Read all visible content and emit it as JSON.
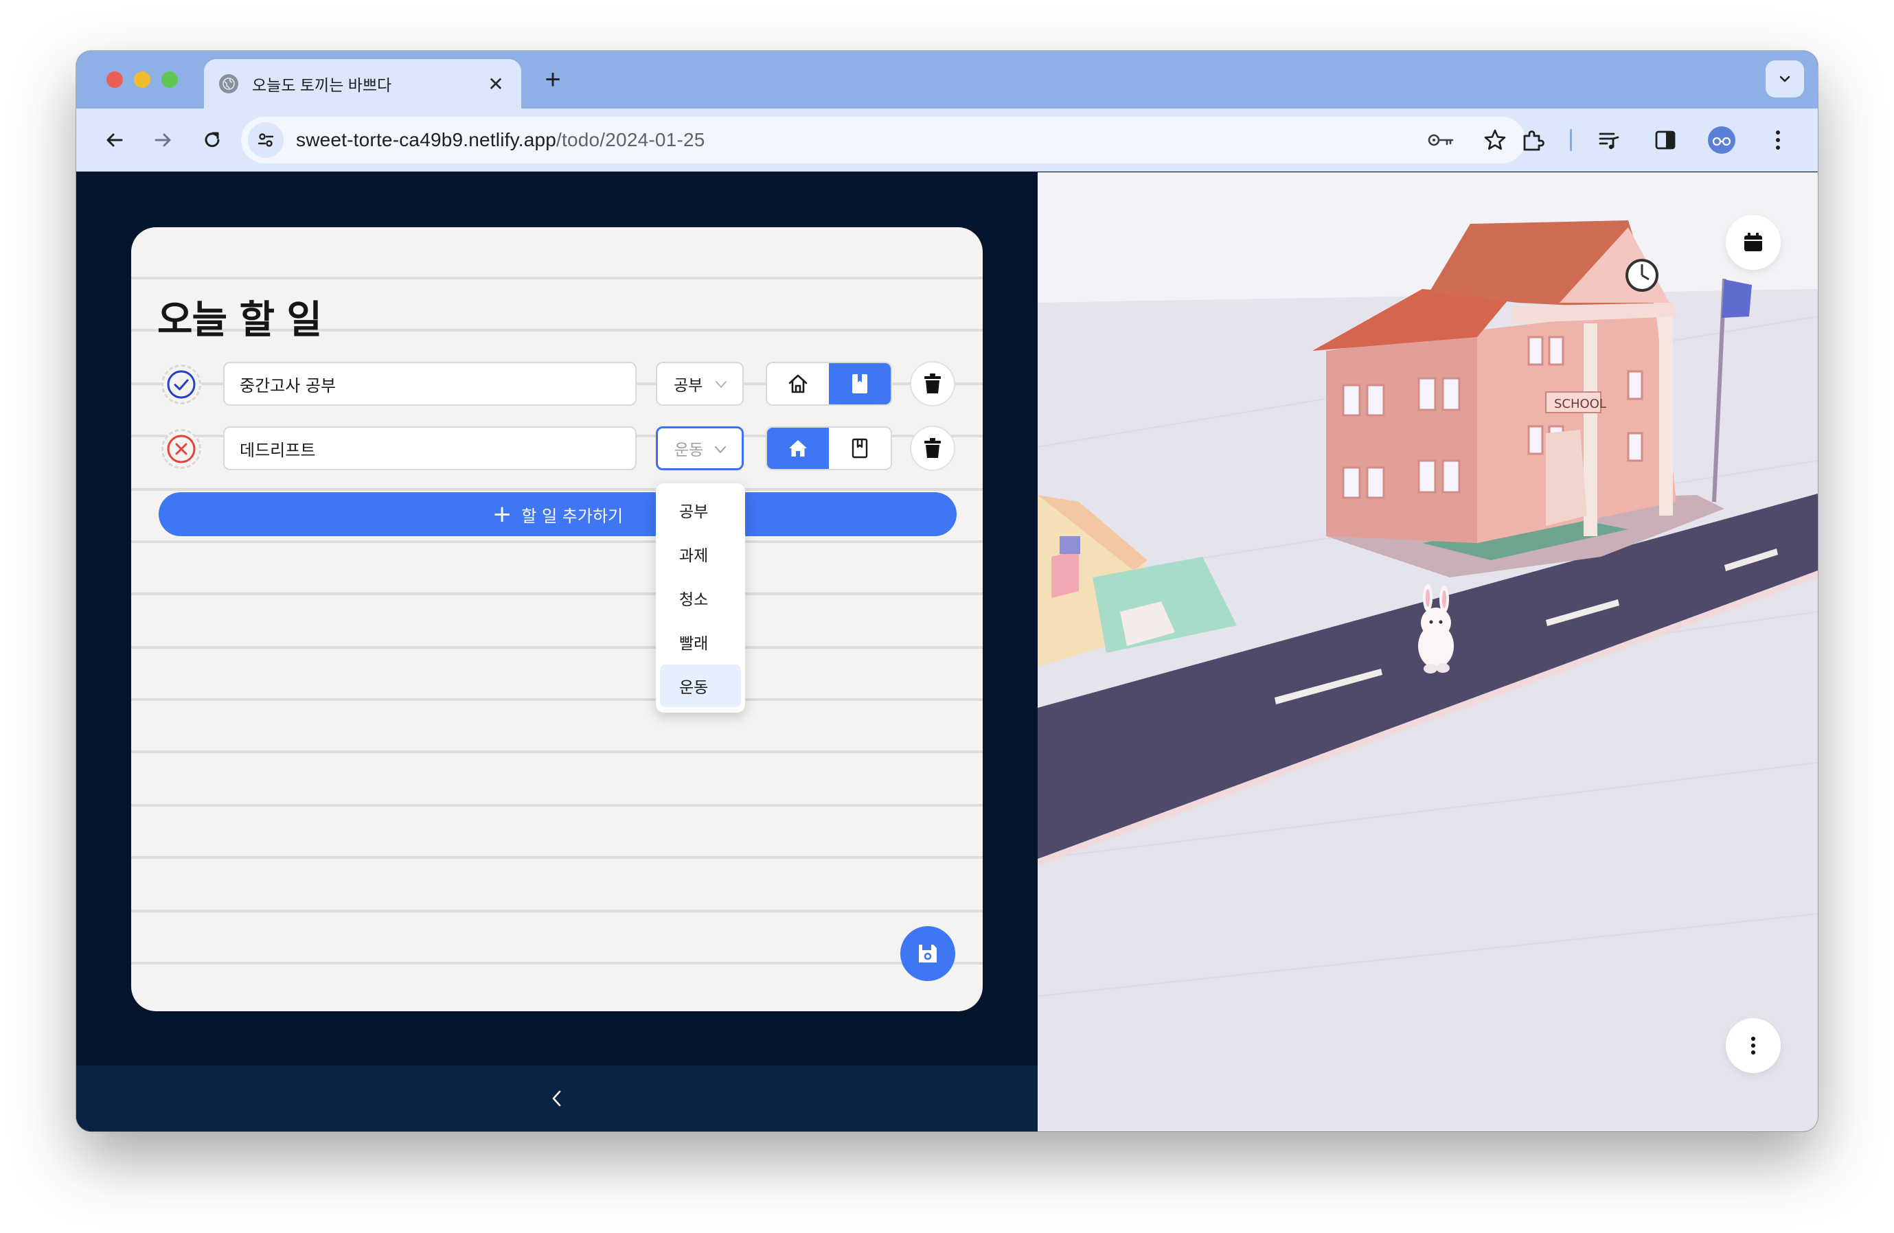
{
  "browser": {
    "tab_title": "오늘도 토끼는 바쁘다",
    "new_tab_symbol": "+",
    "close_symbol": "✕",
    "url_host": "sweet-torte-ca49b9.netlify.app",
    "url_path": "/todo/2024-01-25"
  },
  "todo": {
    "title": "오늘 할 일",
    "items": [
      {
        "text": "중간고사 공부",
        "category": "공부",
        "status": "done",
        "place": "book",
        "dropdown_open": false
      },
      {
        "text": "데드리프트",
        "category": "운동",
        "status": "failed",
        "place": "home",
        "dropdown_open": true
      }
    ],
    "add_label": "할 일 추가하기",
    "add_symbol": "+",
    "dropdown_options": [
      "공부",
      "과제",
      "청소",
      "빨래",
      "운동"
    ],
    "dropdown_selected": "운동"
  },
  "icons": {
    "done": "check-circle-icon",
    "failed": "x-circle-icon",
    "home": "home-icon",
    "book": "book-icon",
    "delete": "trash-icon",
    "save": "floppy-disk-icon",
    "calendar": "calendar-icon",
    "more": "more-vertical-icon",
    "collapse": "chevron-left-icon"
  },
  "colors": {
    "accent": "#3f76f4",
    "done": "#2340c6",
    "failed": "#e0443a",
    "left_bg": "#05152b",
    "card_bg": "#f4f3f1"
  }
}
